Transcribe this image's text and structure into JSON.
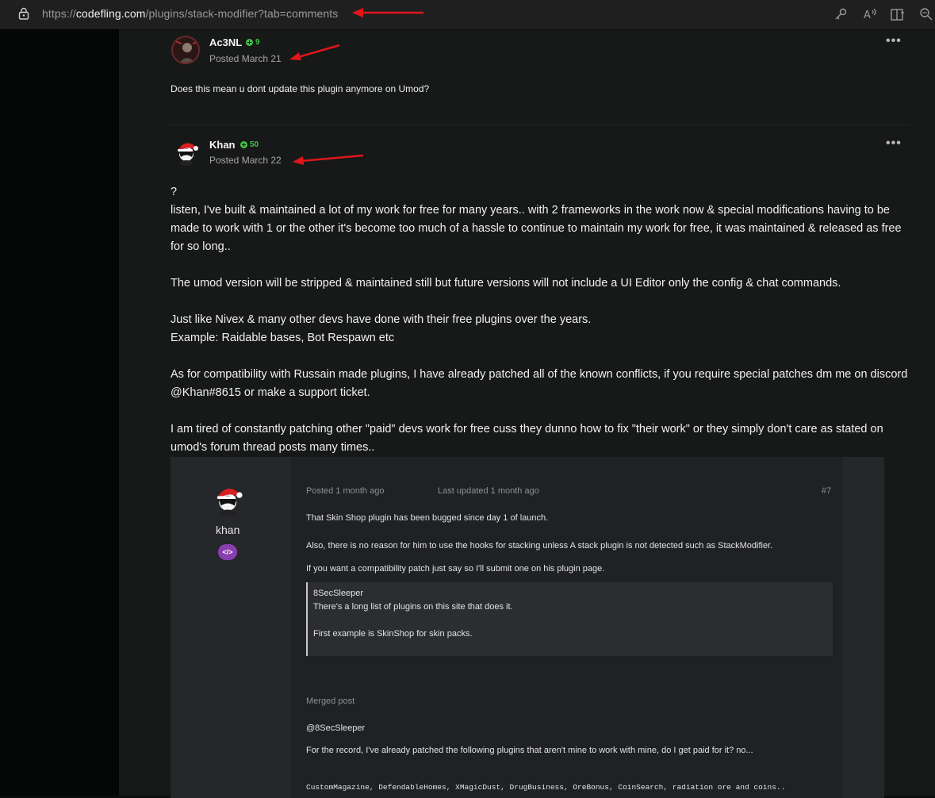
{
  "browser": {
    "url_prefix": "https://",
    "url_domain": "codefling.com",
    "url_path": "/plugins/stack-modifier?tab=comments",
    "toolbar_icons": [
      "key-icon",
      "read-aloud-icon",
      "reading-view-icon",
      "zoom-icon"
    ]
  },
  "colors": {
    "accent_green": "#44c04a",
    "annotation_arrow": "#e0161b",
    "badge_purple": "#8a3fb0"
  },
  "posts": [
    {
      "author": "Ac3NL",
      "reputation": "9",
      "posted": "Posted March 21",
      "body": "Does this mean u dont update this plugin anymore on Umod?"
    },
    {
      "author": "Khan",
      "reputation": "50",
      "posted": "Posted March 22",
      "paragraphs": [
        "?",
        "listen, I've built & maintained a lot of my work for free for many years.. with 2 frameworks in the work now & special modifications having to be made to work with 1 or the other it's become too much of a hassle to continue to maintain my work for free, it was maintained & released as free for so long..",
        "",
        "The umod version will be stripped & maintained still but future versions will not include a UI Editor only the config & chat commands.",
        "",
        "Just like Nivex & many other devs have done with their free plugins over the years.",
        "Example: Raidable bases, Bot Respawn etc",
        "",
        "As for compatibility with Russain made plugins, I have already patched all of the known conflicts, if you require special patches dm me on discord @Khan#8615 or make a support ticket.",
        "",
        "I am tired of constantly patching other \"paid\" devs work for free cuss they dunno how to fix \"their work\" or they simply don't care as stated on umod's forum thread posts many times.."
      ]
    }
  ],
  "embedded": {
    "username": "khan",
    "badge": "</>",
    "posted": "Posted 1 month ago",
    "updated": "Last updated 1 month ago",
    "post_number": "#7",
    "line1": "That Skin Shop plugin has been bugged since day 1 of launch.",
    "line2": "Also, there is no reason for him to use the hooks for stacking unless A stack plugin is not detected such as StackModifier.",
    "line3": "If you want a compatibility patch just say so I'll submit one on his plugin page.",
    "quote_author": "8SecSleeper",
    "quote_line1": "There's a long list of plugins on this site that does it.",
    "quote_line2": "First example is SkinShop for skin packs.",
    "merged": "Merged post",
    "mention": "@8SecSleeper",
    "record": "For the record, I've already patched the following plugins that aren't mine to work with mine, do I get paid for it? no...",
    "plugin_list": "CustomMagazine, DefendableHomes, XMagicDust, DrugBusiness, OreBonus, CoinSearch, radiation ore and coins.."
  }
}
